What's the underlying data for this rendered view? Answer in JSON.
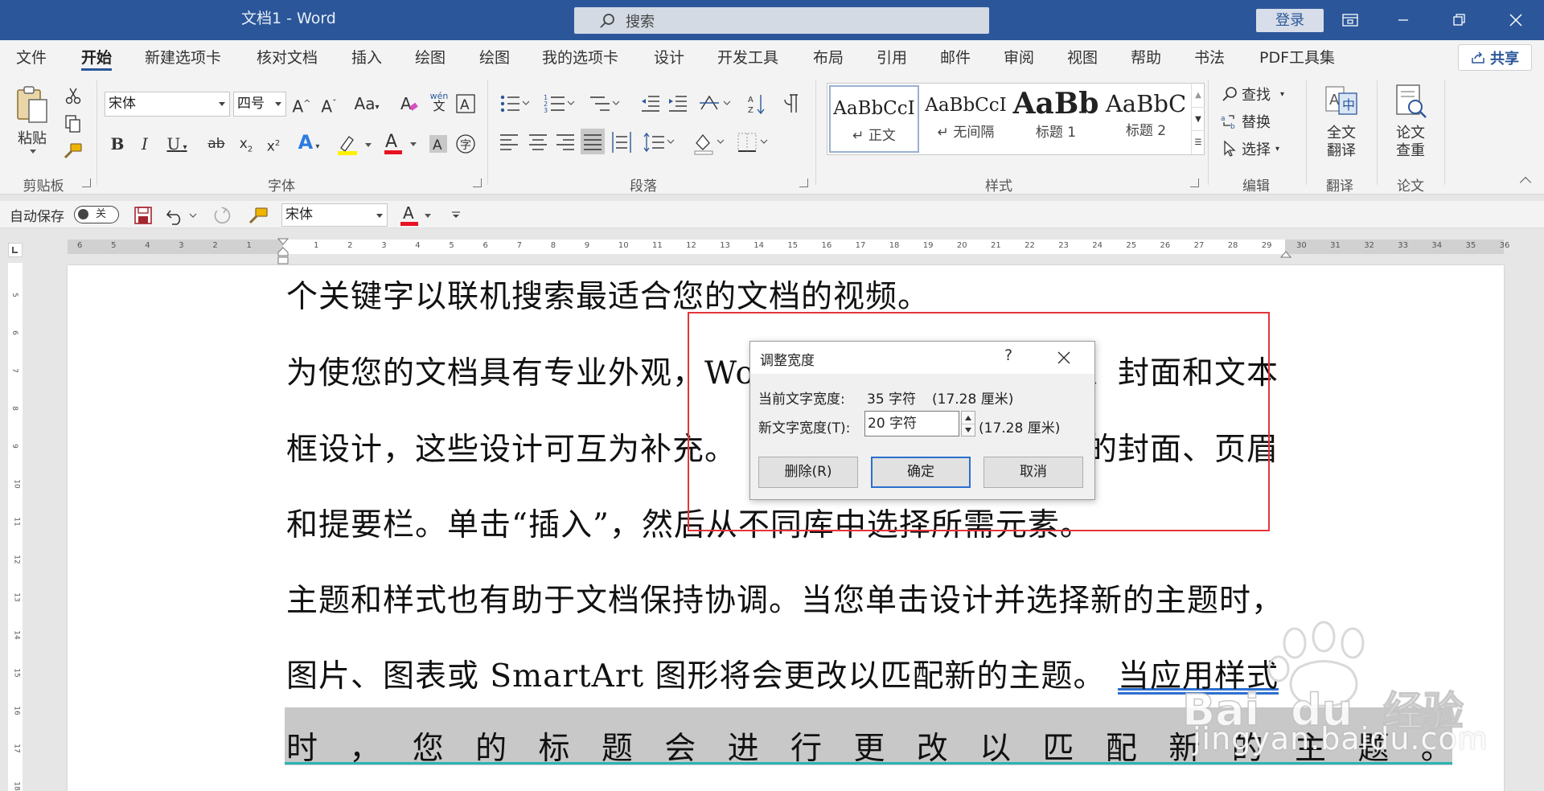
{
  "window": {
    "title": "文档1  -  Word",
    "search_placeholder": "搜索",
    "login": "登录"
  },
  "tabs": [
    "文件",
    "开始",
    "新建选项卡",
    "核对文档",
    "插入",
    "绘图",
    "绘图",
    "我的选项卡",
    "设计",
    "开发工具",
    "布局",
    "引用",
    "邮件",
    "审阅",
    "视图",
    "帮助",
    "书法",
    "PDF工具集"
  ],
  "active_tab": "开始",
  "share": "共享",
  "ribbon": {
    "clipboard": {
      "paste": "粘贴",
      "label": "剪贴板"
    },
    "font": {
      "name": "宋体",
      "size": "四号",
      "label": "字体",
      "case": "Aa",
      "phonetic_top": "wén",
      "phonetic_bottom": "文"
    },
    "paragraph": {
      "label": "段落"
    },
    "styles": {
      "label": "样式",
      "items": [
        {
          "sample": "AaBbCcI",
          "name": "↵ 正文"
        },
        {
          "sample": "AaBbCcI",
          "name": "↵ 无间隔"
        },
        {
          "sample": "AaBb",
          "name": "标题 1"
        },
        {
          "sample": "AaBbC",
          "name": "标题 2"
        }
      ]
    },
    "editing": {
      "find": "查找",
      "replace": "替换",
      "select": "选择",
      "label": "编辑"
    },
    "translate": {
      "line1": "全文",
      "line2": "翻译",
      "label": "翻译"
    },
    "paper": {
      "line1": "论文",
      "line2": "查重",
      "label": "论文"
    }
  },
  "qat": {
    "autosave": "自动保存",
    "toggle": "关",
    "font": "宋体"
  },
  "ruler": {
    "left_ticks": [
      "6",
      "5",
      "4",
      "3",
      "2",
      "1"
    ],
    "center_ticks": [
      "1",
      "2",
      "3",
      "4",
      "5",
      "6",
      "7",
      "8",
      "9",
      "10",
      "11",
      "12",
      "13",
      "14",
      "15",
      "16",
      "17",
      "18",
      "19",
      "20",
      "21",
      "22",
      "23",
      "24",
      "25",
      "26",
      "27",
      "28",
      "29"
    ],
    "right_ticks": [
      "30",
      "31",
      "32",
      "33",
      "34",
      "35",
      "36"
    ],
    "vertical_ticks": [
      "5",
      "6",
      "7",
      "8",
      "9",
      "10",
      "11",
      "12",
      "13",
      "14",
      "15",
      "16",
      "17",
      "18"
    ]
  },
  "document": {
    "lines": [
      "个关键字以联机搜索最适合您的文档的视频。",
      "为使您的文档具有专业外观，Wo",
      "、封面和文本",
      "框设计，这些设计可互为补充。",
      "的封面、页眉",
      "和提要栏。单击“插入”，然后从不同库中选择所需元素。",
      "主题和样式也有助于文档保持协调。当您单击设计并选择新的主题时，",
      "图片、图表或 SmartArt 图形将会更改以匹配新的主题。",
      "当应用样式"
    ],
    "justified_line": [
      "时",
      "，",
      "您",
      "的",
      "标",
      "题",
      "会",
      "进",
      "行",
      "更",
      "改",
      "以",
      "匹",
      "配",
      "新",
      "的",
      "主",
      "题",
      "。"
    ]
  },
  "dialog": {
    "title": "调整宽度",
    "help": "?",
    "current_label": "当前文字宽度:",
    "current_value": "35 字符",
    "current_cm": "(17.28 厘米)",
    "new_label": "新文字宽度(T):",
    "new_value": "20 字符",
    "new_cm": "(17.28 厘米)",
    "delete": "删除(R)",
    "ok": "确定",
    "cancel": "取消"
  },
  "watermark": {
    "brand": "Bai",
    "brand2": "经验",
    "url": "jingyan.baidu.com"
  },
  "colors": {
    "titlebar": "#2b579a",
    "accent": "#2b579a",
    "highlight_box": "#e3353a",
    "font_red": "#e81123",
    "highlight_yellow": "#ffef00"
  }
}
